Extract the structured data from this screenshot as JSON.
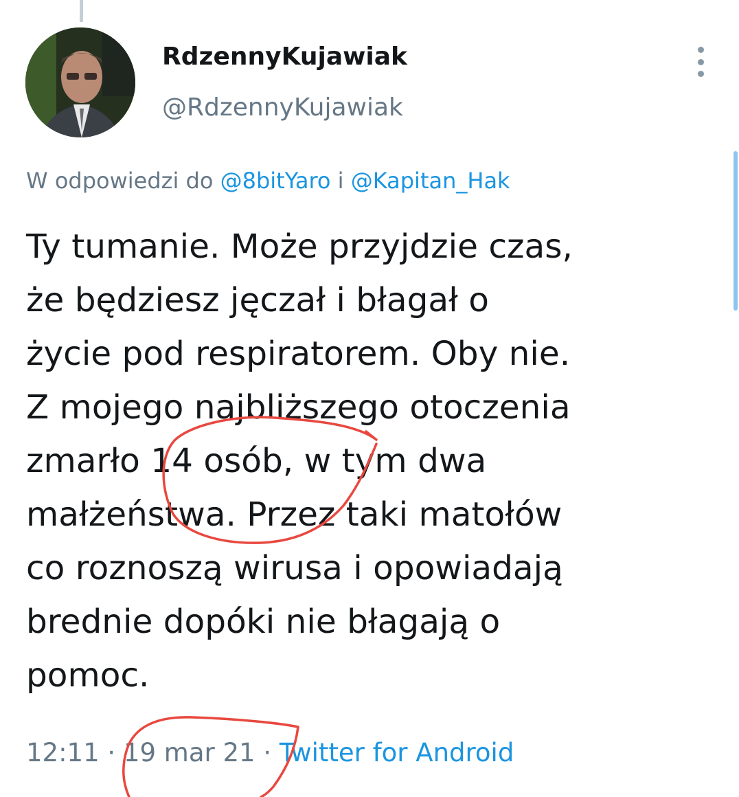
{
  "tweet": {
    "display_name": "RdzennyKujawiak",
    "handle": "@RdzennyKujawiak",
    "reply_prefix": "W odpowiedzi do ",
    "reply_mention_1": "@8bitYaro",
    "reply_joiner": " i ",
    "reply_mention_2": "@Kapitan_Hak",
    "text_lines": [
      "Ty tumanie. Może przyjdzie czas,",
      "że będziesz jęczał i błagał o",
      "życie pod respiratorem. Oby nie.",
      "Z mojego najbliższego otoczenia",
      "zmarło 14 osób, w tym dwa",
      "małżeństwa. Przez taki matołów",
      "co roznoszą wirusa i opowiadają",
      "brednie dopóki nie błagają o",
      "pomoc."
    ],
    "time": "12:11",
    "separator_1": " · ",
    "date": "19 mar 21",
    "separator_2": " · ",
    "source": "Twitter for Android"
  },
  "icons": {
    "more": "more-vertical-icon"
  },
  "colors": {
    "text": "#14171a",
    "secondary": "#657786",
    "link": "#1b95e0",
    "annotation_red": "#e8483f",
    "thread_line": "#c4cfd6"
  }
}
